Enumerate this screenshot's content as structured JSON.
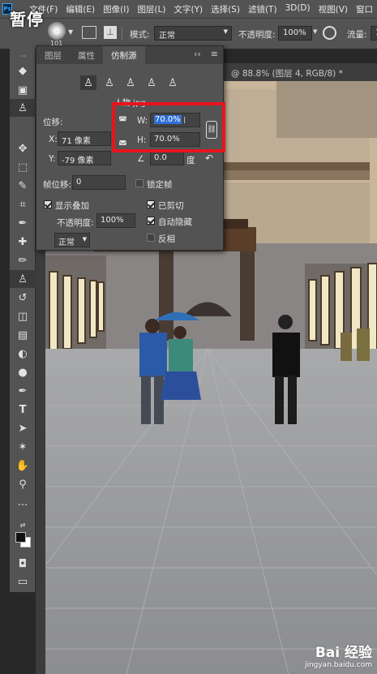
{
  "overlay": {
    "pause_label": "暂停"
  },
  "menubar": {
    "logo": "Ps",
    "items": [
      "文件(F)",
      "编辑(E)",
      "图像(I)",
      "图层(L)",
      "文字(Y)",
      "选择(S)",
      "滤镜(T)",
      "3D(D)",
      "视图(V)",
      "窗口"
    ]
  },
  "options": {
    "brush_size": "101",
    "mode_label": "模式:",
    "mode_value": "正常",
    "opacity_label": "不透明度:",
    "opacity_value": "100%",
    "flow_label": "流量:",
    "flow_value": "1"
  },
  "document": {
    "tab_title": "@ 88.8% (图层 4, RGB/8) *"
  },
  "panel": {
    "tabs": [
      "图层",
      "属性",
      "仿制源"
    ],
    "active_tab_index": 2,
    "source_file": "人物.jpg",
    "offset_label": "位移:",
    "x_label": "X:",
    "x_value": "71 像素",
    "y_label": "Y:",
    "y_value": "-79 像素",
    "w_label": "W:",
    "w_value": "70.0%",
    "h_label": "H:",
    "h_value": "70.0%",
    "angle_value": "0.0",
    "angle_unit": "度",
    "frame_offset_label": "帧位移:",
    "frame_offset_value": "0",
    "lock_frame_label": "锁定帧",
    "show_overlay_label": "显示叠加",
    "overlay_opacity_label": "不透明度:",
    "overlay_opacity_value": "100%",
    "blend_mode_value": "正常",
    "clipped_label": "已剪切",
    "auto_hide_label": "自动隐藏",
    "invert_label": "反相",
    "states": {
      "show_overlay": true,
      "clipped": true,
      "auto_hide": true,
      "invert": false,
      "lock_frame": false
    }
  },
  "watermark": {
    "brand": "Bai 经验",
    "url": "jingyan.baidu.com"
  },
  "colors": {
    "highlight": "#e8141c",
    "selection": "#2f6fd6"
  }
}
